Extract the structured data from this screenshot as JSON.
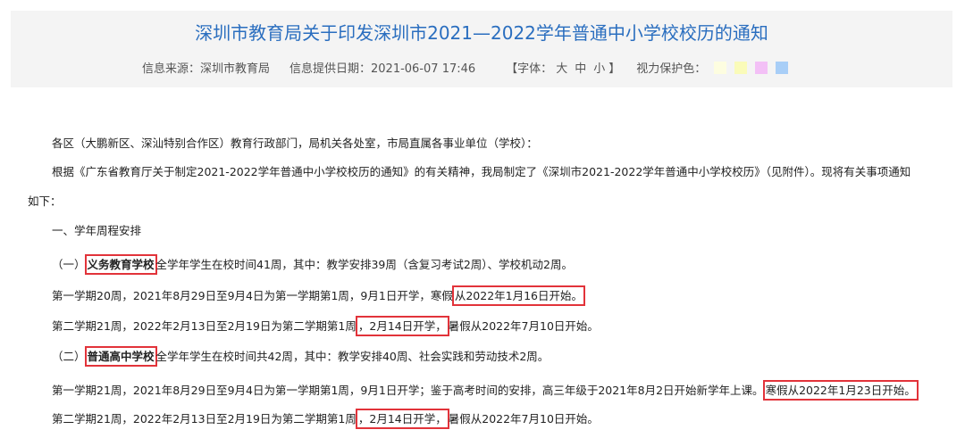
{
  "header": {
    "title": "深圳市教育局关于印发深圳市2021—2022学年普通中小学校校历的通知",
    "source": "信息来源：深圳市教育局",
    "date": "信息提供日期：2021-06-07 17:46",
    "font_label": "【字体：",
    "font_large": "大",
    "font_medium": "中",
    "font_small": "小",
    "font_close": "】",
    "eye_care_label": "视力保护色：",
    "swatch_colors": [
      "#fdfde0",
      "#fafbb9",
      "#f3c0f6",
      "#a8cef7"
    ]
  },
  "body": {
    "p1": "各区（大鹏新区、深汕特别合作区）教育行政部门，局机关各处室，市局直属各事业单位（学校）：",
    "p2": "根据《广东省教育厅关于制定2021-2022学年普通中小学校校历的通知》的有关精神，我局制定了《深圳市2021-2022学年普通中小学校校历》（见附件）。现将有关事项通知",
    "p2b": "如下：",
    "p3": "一、学年周程安排",
    "p4a": "（一）",
    "p4b": "义务教育学校",
    "p4c": "全学年学生在校时间41周，其中：教学安排39周（含复习考试2周）、学校机动2周。",
    "p5a": "第一学期20周，2021年8月29日至9月4日为第一学期第1周，9月1日开学，寒假",
    "p5b": "从2022年1月16日开始。",
    "p6a": "第二学期21周，2022年2月13日至2月19日为第二学期第1周",
    "p6b": "，2月14日开学，",
    "p6c": "暑假从2022年7月10日开始。",
    "p7a": "（二）",
    "p7b": "普通高中学校",
    "p7c": "全学年学生在校时间共42周，其中：教学安排40周、社会实践和劳动技术2周。",
    "p8a": "第一学期21周，2021年8月29日至9月4日为第一学期第1周，9月1日开学；鉴于高考时间的安排，高三年级于2021年8月2日开始新学年上课。",
    "p8b": "寒假从2022年1月23日开始。",
    "p9a": "第二学期21周，2022年2月13日至2月19日为第二学期第1周",
    "p9b": "，2月14日开学，",
    "p9c": "暑假从2022年7月10日开始。"
  }
}
